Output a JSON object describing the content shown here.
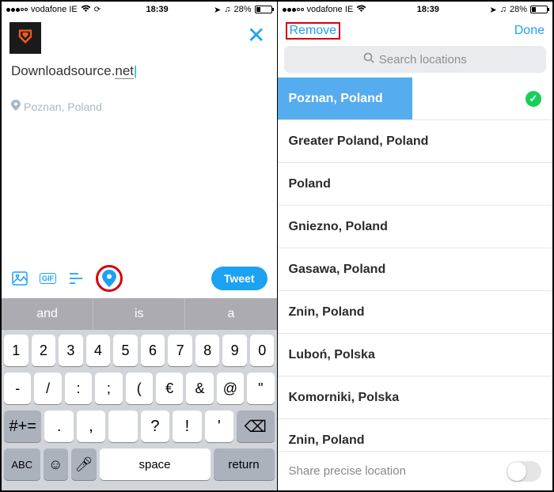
{
  "status": {
    "carrier": "vodafone IE",
    "wifi": "wifi",
    "time": "18:39",
    "battery_pct": "28%"
  },
  "compose": {
    "text_main": "Downloadsource.",
    "text_net": "net",
    "location": "Poznan, Poland",
    "tweet_btn": "Tweet"
  },
  "suggestions": [
    "and",
    "is",
    "a"
  ],
  "keyboard": {
    "row1": [
      "1",
      "2",
      "3",
      "4",
      "5",
      "6",
      "7",
      "8",
      "9",
      "0"
    ],
    "row2": [
      "-",
      "/",
      ":",
      ";",
      "(",
      "€",
      "&",
      "@",
      "\""
    ],
    "shift": "#+=",
    "row3": [
      ".",
      ",",
      "",
      "?",
      "!",
      "'"
    ],
    "abc": "ABC",
    "space": "space",
    "return": "return"
  },
  "screen2": {
    "remove": "Remove",
    "done": "Done",
    "search_placeholder": "Search locations",
    "selected": "Poznan, Poland",
    "locations": [
      "Greater Poland, Poland",
      "Poland",
      "Gniezno, Poland",
      "Gasawa, Poland",
      "Znin, Poland",
      "Luboń, Polska",
      "Komorniki, Polska",
      "Znin, Poland"
    ],
    "share_label": "Share precise location"
  }
}
